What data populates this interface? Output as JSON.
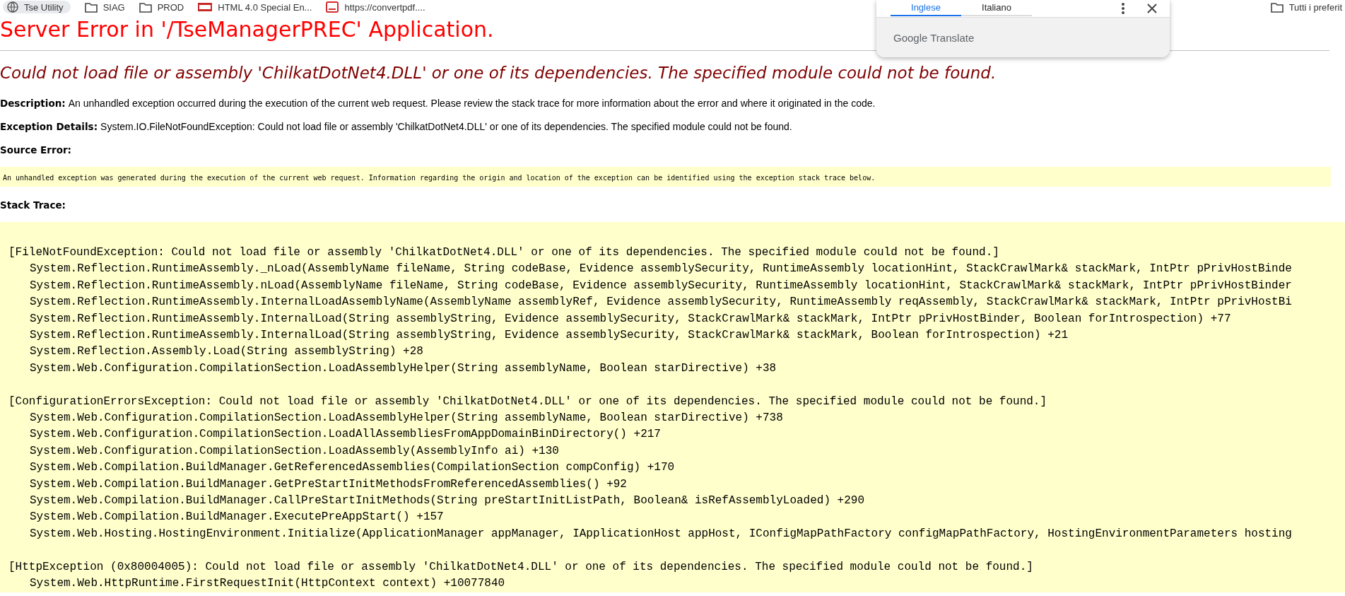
{
  "bookmarks_bar": {
    "items": [
      {
        "label": "Tse Utility",
        "kind": "chip"
      },
      {
        "label": "SIAG",
        "kind": "folder"
      },
      {
        "label": "PROD",
        "kind": "folder"
      },
      {
        "label": "HTML 4.0 Special En...",
        "kind": "html"
      },
      {
        "label": "https://convertpdf....",
        "kind": "pdf"
      }
    ],
    "all_bookmarks": "Tutti i preferit"
  },
  "translate_popup": {
    "tabs": [
      {
        "label": "Inglese",
        "selected": true
      },
      {
        "label": "Italiano",
        "selected": false
      }
    ],
    "brand": "Google Translate"
  },
  "error_page": {
    "title": "Server Error in '/TseManagerPREC' Application.",
    "message": "Could not load file or assembly 'ChilkatDotNet4.DLL' or one of its dependencies. The specified module could not be found.",
    "description": {
      "label": "Description:",
      "text": "An unhandled exception occurred during the execution of the current web request. Please review the stack trace for more information about the error and where it originated in the code."
    },
    "exception_details": {
      "label": "Exception Details:",
      "text": "System.IO.FileNotFoundException: Could not load file or assembly 'ChilkatDotNet4.DLL' or one of its dependencies. The specified module could not be found."
    },
    "source_error": {
      "label": "Source Error:",
      "text": "An unhandled exception was generated during the execution of the current web request. Information regarding the origin and location of the exception can be identified using the exception stack trace below."
    },
    "stack_trace": {
      "label": "Stack Trace:",
      "groups": [
        {
          "header": "[FileNotFoundException: Could not load file or assembly 'ChilkatDotNet4.DLL' or one of its dependencies. The specified module could not be found.]",
          "frames": [
            "System.Reflection.RuntimeAssembly._nLoad(AssemblyName fileName, String codeBase, Evidence assemblySecurity, RuntimeAssembly locationHint, StackCrawlMark& stackMark, IntPtr pPrivHostBinde",
            "System.Reflection.RuntimeAssembly.nLoad(AssemblyName fileName, String codeBase, Evidence assemblySecurity, RuntimeAssembly locationHint, StackCrawlMark& stackMark, IntPtr pPrivHostBinder",
            "System.Reflection.RuntimeAssembly.InternalLoadAssemblyName(AssemblyName assemblyRef, Evidence assemblySecurity, RuntimeAssembly reqAssembly, StackCrawlMark& stackMark, IntPtr pPrivHostBi",
            "System.Reflection.RuntimeAssembly.InternalLoad(String assemblyString, Evidence assemblySecurity, StackCrawlMark& stackMark, IntPtr pPrivHostBinder, Boolean forIntrospection) +77",
            "System.Reflection.RuntimeAssembly.InternalLoad(String assemblyString, Evidence assemblySecurity, StackCrawlMark& stackMark, Boolean forIntrospection) +21",
            "System.Reflection.Assembly.Load(String assemblyString) +28",
            "System.Web.Configuration.CompilationSection.LoadAssemblyHelper(String assemblyName, Boolean starDirective) +38"
          ]
        },
        {
          "header": "[ConfigurationErrorsException: Could not load file or assembly 'ChilkatDotNet4.DLL' or one of its dependencies. The specified module could not be found.]",
          "frames": [
            "System.Web.Configuration.CompilationSection.LoadAssemblyHelper(String assemblyName, Boolean starDirective) +738",
            "System.Web.Configuration.CompilationSection.LoadAllAssembliesFromAppDomainBinDirectory() +217",
            "System.Web.Configuration.CompilationSection.LoadAssembly(AssemblyInfo ai) +130",
            "System.Web.Compilation.BuildManager.GetReferencedAssemblies(CompilationSection compConfig) +170",
            "System.Web.Compilation.BuildManager.GetPreStartInitMethodsFromReferencedAssemblies() +92",
            "System.Web.Compilation.BuildManager.CallPreStartInitMethods(String preStartInitListPath, Boolean& isRefAssemblyLoaded) +290",
            "System.Web.Compilation.BuildManager.ExecutePreAppStart() +157",
            "System.Web.Hosting.HostingEnvironment.Initialize(ApplicationManager appManager, IApplicationHost appHost, IConfigMapPathFactory configMapPathFactory, HostingEnvironmentParameters hosting"
          ]
        },
        {
          "header": "[HttpException (0x80004005): Could not load file or assembly 'ChilkatDotNet4.DLL' or one of its dependencies. The specified module could not be found.]",
          "frames": [
            "System.Web.HttpRuntime.FirstRequestInit(HttpContext context) +10077840"
          ]
        }
      ]
    }
  }
}
